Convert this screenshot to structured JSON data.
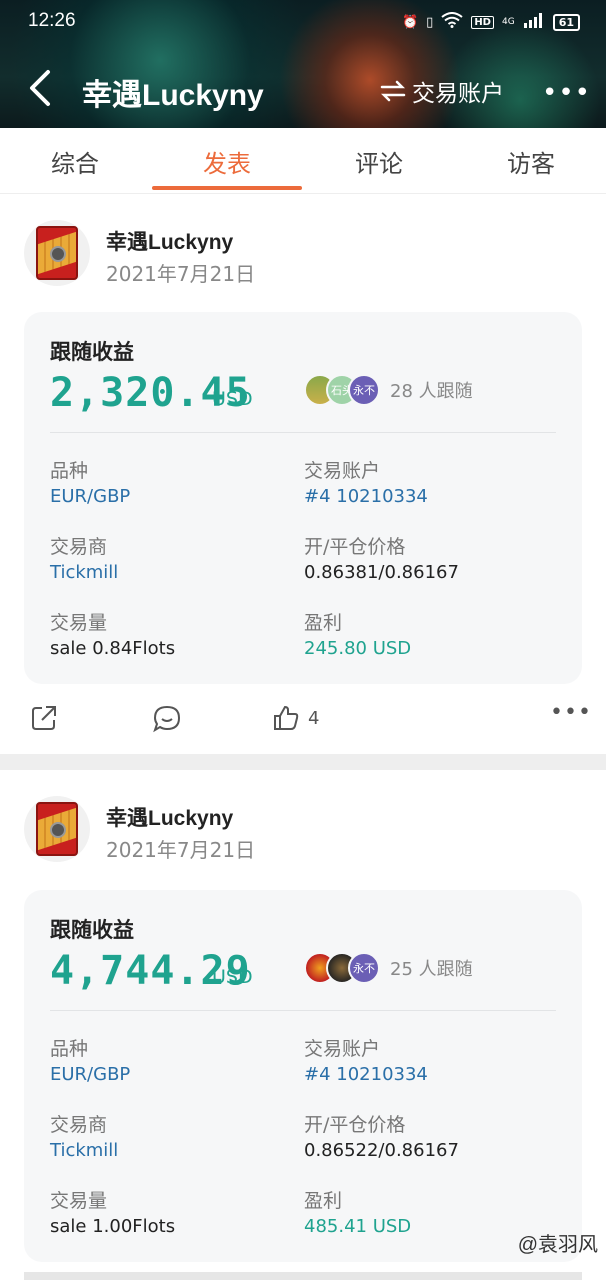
{
  "status": {
    "time": "12:26",
    "hd": "HD",
    "network": "4G",
    "battery": "61"
  },
  "header": {
    "title": "幸遇Luckyny",
    "switch_label": "交易账户",
    "more": "•••"
  },
  "tabs": [
    {
      "label": "综合"
    },
    {
      "label": "发表"
    },
    {
      "label": "评论"
    },
    {
      "label": "访客"
    }
  ],
  "active_tab": "发表",
  "posts": [
    {
      "username": "幸遇Luckyny",
      "date": "2021年7月21日",
      "card": {
        "label": "跟随收益",
        "amount": "2,320.45",
        "currency": "USD",
        "followers_text": "28 人跟随",
        "follower_avatars": [
          "",
          "石头",
          "永不"
        ],
        "fields": {
          "symbol_label": "品种",
          "symbol": "EUR/GBP",
          "account_label": "交易账户",
          "account": "#4 10210334",
          "broker_label": "交易商",
          "broker": "Tickmill",
          "price_label": "开/平仓价格",
          "price": "0.86381/0.86167",
          "volume_label": "交易量",
          "volume": "sale 0.84Flots",
          "profit_label": "盈利",
          "profit": "245.80 USD"
        }
      },
      "likes": "4"
    },
    {
      "username": "幸遇Luckyny",
      "date": "2021年7月21日",
      "card": {
        "label": "跟随收益",
        "amount": "4,744.29",
        "currency": "USD",
        "followers_text": "25 人跟随",
        "follower_avatars": [
          "",
          "",
          "永不"
        ],
        "fields": {
          "symbol_label": "品种",
          "symbol": "EUR/GBP",
          "account_label": "交易账户",
          "account": "#4 10210334",
          "broker_label": "交易商",
          "broker": "Tickmill",
          "price_label": "开/平仓价格",
          "price": "0.86522/0.86167",
          "volume_label": "交易量",
          "volume": "sale 1.00Flots",
          "profit_label": "盈利",
          "profit": "485.41 USD"
        }
      }
    }
  ],
  "watermark": "@袁羽风",
  "colors": {
    "accent": "#ec6b3b",
    "profit_green": "#1fa38f",
    "link_blue": "#2a6fa8"
  }
}
